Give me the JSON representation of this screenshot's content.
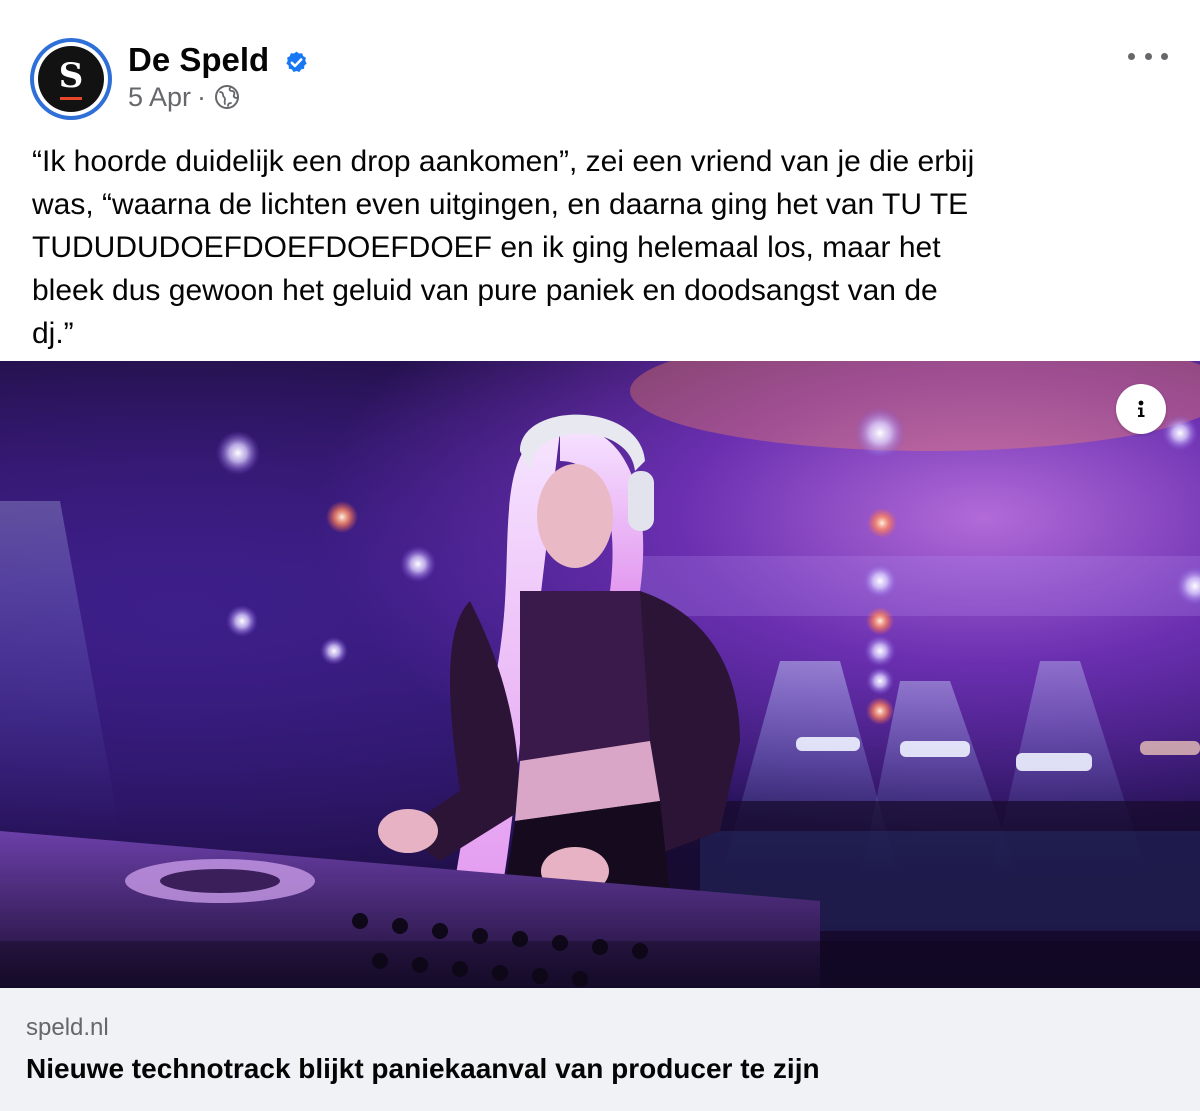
{
  "post": {
    "page_name": "De Speld",
    "avatar_letter": "S",
    "verified_icon": "verified-badge-icon",
    "date": "5 Apr",
    "separator": "·",
    "audience_icon": "globe-icon",
    "more_icon": "more-options-icon",
    "text_lines": [
      "“Ik hoorde duidelijk een drop aankomen”, zei een vriend van je die erbij",
      "was, “waarna de lichten even uitgingen, en daarna ging het van TU TE",
      "TUDUDUDOEFDOEFDOEFDOEF en ik ging helemaal los, maar het",
      "bleek dus gewoon het geluid van pure paniek en doodsangst van de",
      "dj.”"
    ]
  },
  "link_preview": {
    "info_icon": "info-icon",
    "domain": "speld.nl",
    "title": "Nieuwe technotrack blijkt paniekaanval van producer te zijn"
  },
  "colors": {
    "accent_blue": "#2f6fd8",
    "verified_blue": "#1877f2",
    "secondary_text": "#65676b",
    "card_background": "#f0f2f5",
    "logo_bar": "#e8462b"
  }
}
